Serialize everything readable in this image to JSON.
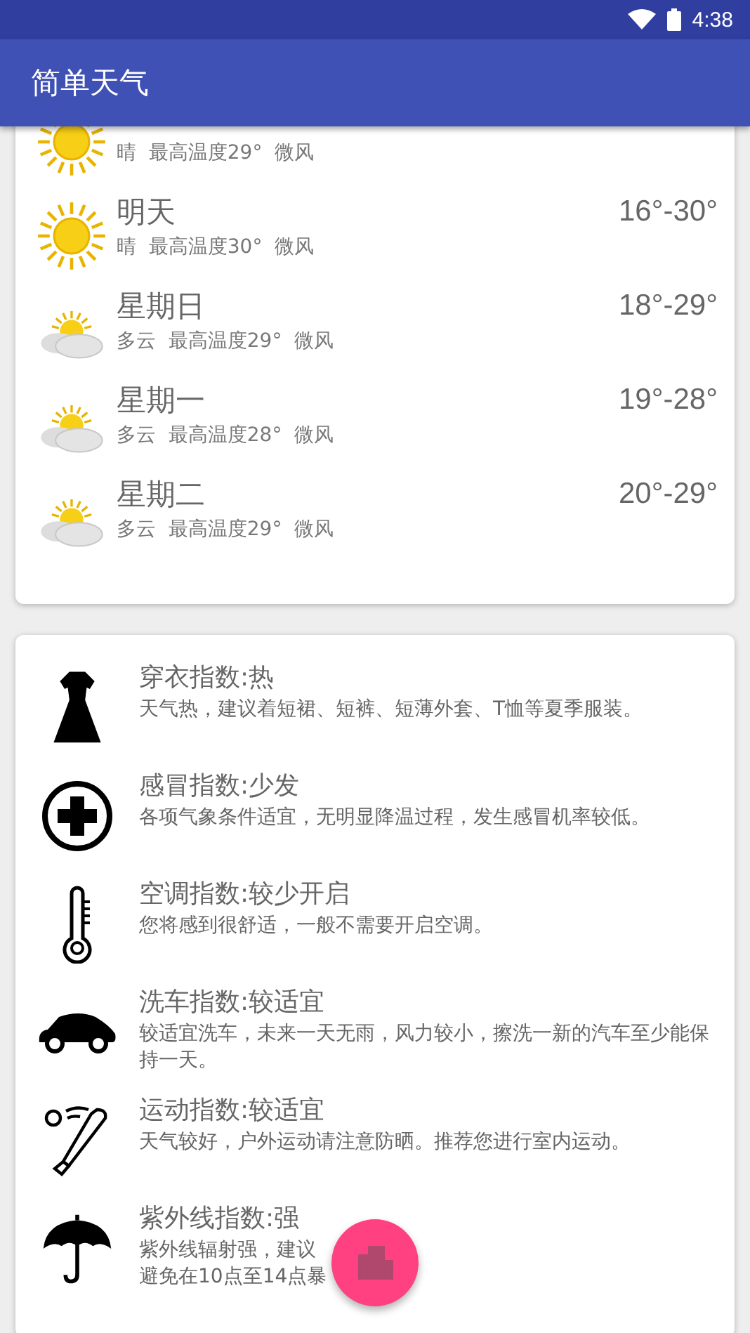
{
  "status_bar": {
    "time": "4:38"
  },
  "app_bar": {
    "title": "简单天气"
  },
  "forecast": [
    {
      "kind": "sunny",
      "summary": "晴  最高温度29°  微风"
    },
    {
      "day": "明天",
      "kind": "sunny",
      "summary": "晴  最高温度30°  微风",
      "range": "16°-30°"
    },
    {
      "day": "星期日",
      "kind": "cloudy",
      "summary": "多云  最高温度29°  微风",
      "range": "18°-29°"
    },
    {
      "day": "星期一",
      "kind": "cloudy",
      "summary": "多云  最高温度28°  微风",
      "range": "19°-28°"
    },
    {
      "day": "星期二",
      "kind": "cloudy",
      "summary": "多云  最高温度29°  微风",
      "range": "20°-29°"
    }
  ],
  "indices": [
    {
      "kind": "dress",
      "title": "穿衣指数:热",
      "text": "天气热，建议着短裙、短裤、短薄外套、T恤等夏季服装。"
    },
    {
      "kind": "cold",
      "title": "感冒指数:少发",
      "text": "各项气象条件适宜，无明显降温过程，发生感冒机率较低。"
    },
    {
      "kind": "aircon",
      "title": "空调指数:较少开启",
      "text": "您将感到很舒适，一般不需要开启空调。"
    },
    {
      "kind": "carwash",
      "title": "洗车指数:较适宜",
      "text": "较适宜洗车，未来一天无雨，风力较小，擦洗一新的汽车至少能保持一天。"
    },
    {
      "kind": "sport",
      "title": "运动指数:较适宜",
      "text": "天气较好，户外运动请注意防晒。推荐您进行室内运动。"
    },
    {
      "kind": "uv",
      "title": "紫外线指数:强",
      "lines": [
        "紫外线辐射强，建议",
        "避免在10点至14点暴"
      ]
    }
  ]
}
